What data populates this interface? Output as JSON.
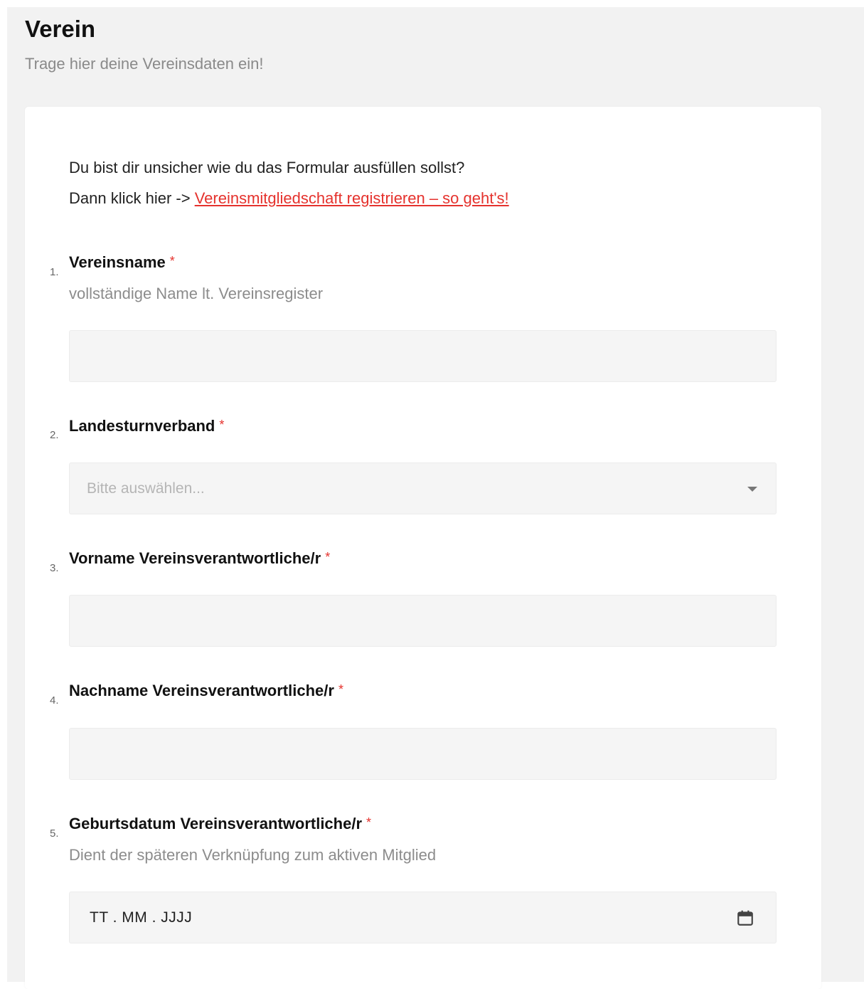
{
  "header": {
    "title": "Verein",
    "subtitle": "Trage hier deine Vereinsdaten ein!"
  },
  "intro": {
    "line1": "Du bist dir unsicher wie du das Formular ausfüllen sollst?",
    "line2_prefix": "Dann klick hier -> ",
    "link_text": "Vereinsmitgliedschaft registrieren – so geht's!"
  },
  "colors": {
    "accent": "#e5322d",
    "page_bg": "#f2f2f2",
    "field_bg": "#f5f5f5"
  },
  "questions": [
    {
      "number": "1.",
      "label": "Vereinsname",
      "required": "*",
      "help": "vollständige Name lt. Vereinsregister",
      "value": ""
    },
    {
      "number": "2.",
      "label": "Landesturnverband",
      "required": "*",
      "placeholder": "Bitte auswählen..."
    },
    {
      "number": "3.",
      "label": "Vorname Vereinsverantwortliche/r",
      "required": "*",
      "value": ""
    },
    {
      "number": "4.",
      "label": "Nachname Vereinsverantwortliche/r",
      "required": "*",
      "value": ""
    },
    {
      "number": "5.",
      "label": "Geburtsdatum Vereinsverantwortliche/r",
      "required": "*",
      "help": "Dient der späteren Verknüpfung zum aktiven Mitglied",
      "placeholder": "TT . MM . JJJJ",
      "icon": "calendar-icon"
    }
  ]
}
